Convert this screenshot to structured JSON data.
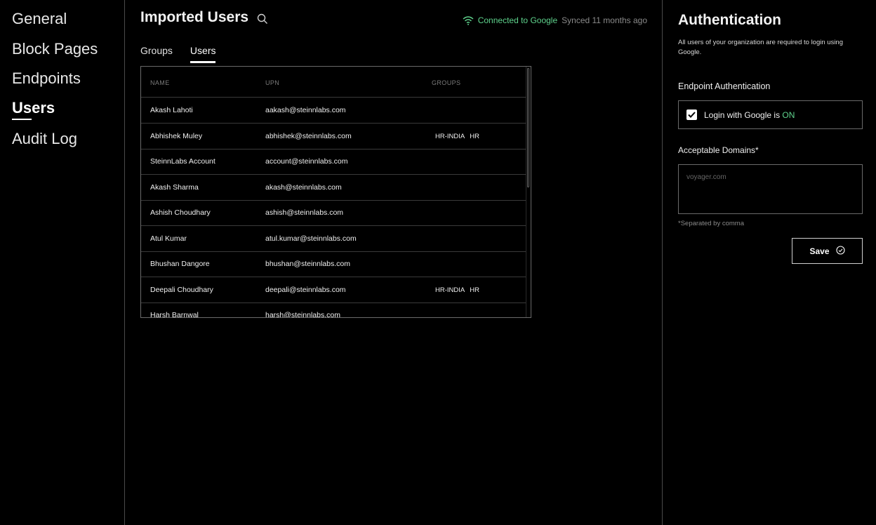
{
  "nav": {
    "items": [
      {
        "label": "General"
      },
      {
        "label": "Block Pages"
      },
      {
        "label": "Endpoints"
      },
      {
        "label": "Users"
      },
      {
        "label": "Audit Log"
      }
    ],
    "active": "Users"
  },
  "main": {
    "title": "Imported Users",
    "connection": {
      "status": "Connected to Google",
      "sync": "Synced 11 months ago"
    },
    "tabs": [
      {
        "label": "Groups"
      },
      {
        "label": "Users"
      }
    ],
    "active_tab": "Users",
    "table": {
      "headers": {
        "name": "NAME",
        "upn": "UPN",
        "groups": "GROUPS"
      },
      "rows": [
        {
          "name": "Akash Lahoti",
          "upn": "aakash@steinnlabs.com",
          "groups": []
        },
        {
          "name": "Abhishek Muley",
          "upn": "abhishek@steinnlabs.com",
          "groups": [
            "HR-INDIA",
            "HR"
          ]
        },
        {
          "name": "SteinnLabs Account",
          "upn": "account@steinnlabs.com",
          "groups": []
        },
        {
          "name": "Akash Sharma",
          "upn": "akash@steinnlabs.com",
          "groups": []
        },
        {
          "name": "Ashish Choudhary",
          "upn": "ashish@steinnlabs.com",
          "groups": []
        },
        {
          "name": "Atul Kumar",
          "upn": "atul.kumar@steinnlabs.com",
          "groups": []
        },
        {
          "name": "Bhushan Dangore",
          "upn": "bhushan@steinnlabs.com",
          "groups": []
        },
        {
          "name": "Deepali Choudhary",
          "upn": "deepali@steinnlabs.com",
          "groups": [
            "HR-INDIA",
            "HR"
          ]
        },
        {
          "name": "Harsh Barnwal",
          "upn": "harsh@steinnlabs.com",
          "groups": []
        }
      ]
    }
  },
  "panel": {
    "title": "Authentication",
    "description": "All users of your organization are required to login using Google.",
    "endpoint_label": "Endpoint Authentication",
    "toggle_text": "Login with Google is ",
    "toggle_state": "ON",
    "domains_label": "Acceptable Domains*",
    "domains_placeholder": "voyager.com",
    "domains_hint": "*Separated by comma",
    "save_label": "Save"
  },
  "colors": {
    "accent_green": "#5fd38d",
    "background": "#000000",
    "border": "#6a6a6a"
  },
  "icons": [
    "search-icon",
    "wifi-icon",
    "check-icon",
    "check-circle-icon"
  ]
}
